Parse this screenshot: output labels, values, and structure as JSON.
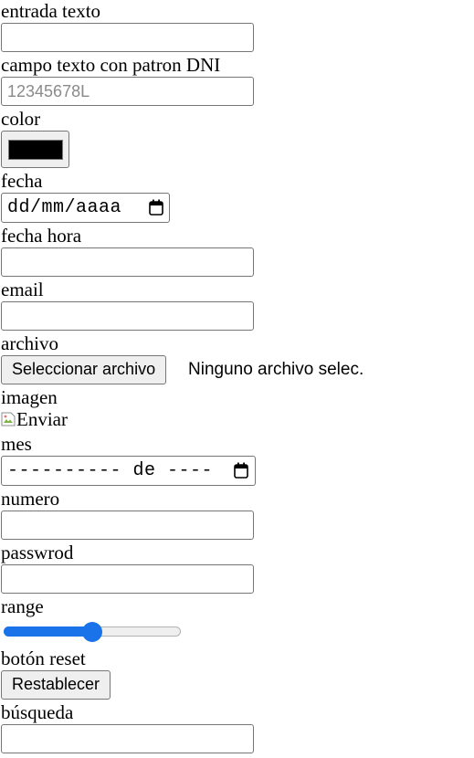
{
  "fields": {
    "text": {
      "label": "entrada texto",
      "value": ""
    },
    "dni": {
      "label": "campo texto con patron DNI",
      "placeholder": "12345678L"
    },
    "color": {
      "label": "color",
      "value": "#000000"
    },
    "date": {
      "label": "fecha",
      "display": "dd/mm/aaaa"
    },
    "datetime": {
      "label": "fecha hora",
      "value": ""
    },
    "email": {
      "label": "email",
      "value": ""
    },
    "file": {
      "label": "archivo",
      "button_label": "Seleccionar archivo",
      "status": "Ninguno archivo selec."
    },
    "image": {
      "label": "imagen",
      "alt": "Enviar"
    },
    "month": {
      "label": "mes",
      "display": "---------- de ----"
    },
    "number": {
      "label": "numero",
      "value": ""
    },
    "password": {
      "label": "passwrod",
      "value": ""
    },
    "range": {
      "label": "range",
      "value_fraction": 0.5
    },
    "reset": {
      "label": "botón reset",
      "button_label": "Restablecer"
    },
    "search": {
      "label": "búsqueda",
      "value": ""
    }
  },
  "colors": {
    "accent": "#1a73e8",
    "border": "#767676",
    "button_bg": "#efefef"
  },
  "icons": {
    "calendar": "calendar-icon",
    "broken_image": "broken-image-icon"
  }
}
